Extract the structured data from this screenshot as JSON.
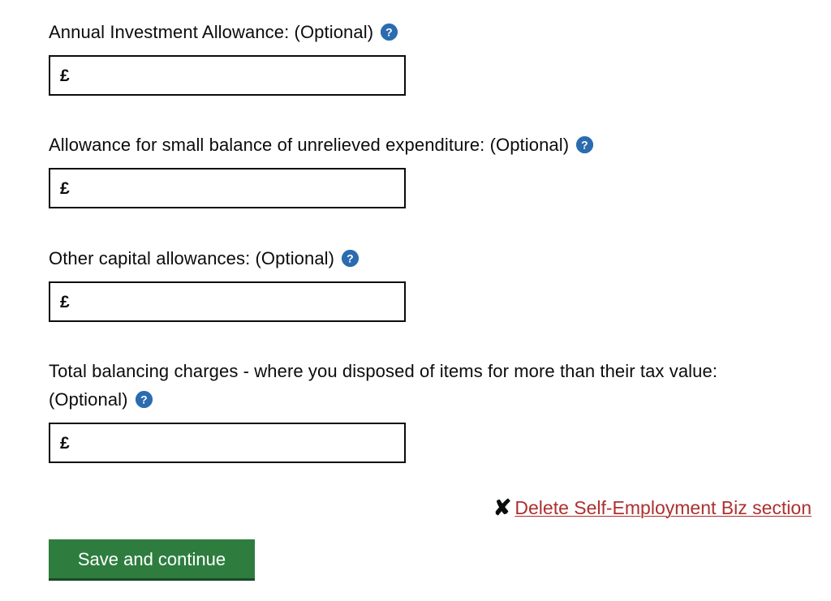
{
  "form": {
    "currency_symbol": "£",
    "help_icon_name": "help-icon",
    "fields": [
      {
        "label": "Annual Investment Allowance: (Optional)",
        "value": "",
        "placeholder": ""
      },
      {
        "label": "Allowance for small balance of unrelieved expenditure: (Optional)",
        "value": "",
        "placeholder": ""
      },
      {
        "label": "Other capital allowances: (Optional)",
        "value": "",
        "placeholder": ""
      },
      {
        "label": "Total balancing charges - where you disposed of items for more than their tax value: (Optional)",
        "value": "",
        "placeholder": ""
      }
    ]
  },
  "delete": {
    "icon": "✘",
    "icon_name": "cross-icon",
    "label": "Delete Self-Employment Biz section"
  },
  "actions": {
    "save_label": "Save and continue"
  },
  "colors": {
    "help_blue": "#2b6cb0",
    "delete_red": "#ad3030",
    "button_green": "#2e7d3f",
    "button_green_shadow": "#1b4a26",
    "text": "#0b0c0c",
    "border": "#0b0c0c"
  }
}
